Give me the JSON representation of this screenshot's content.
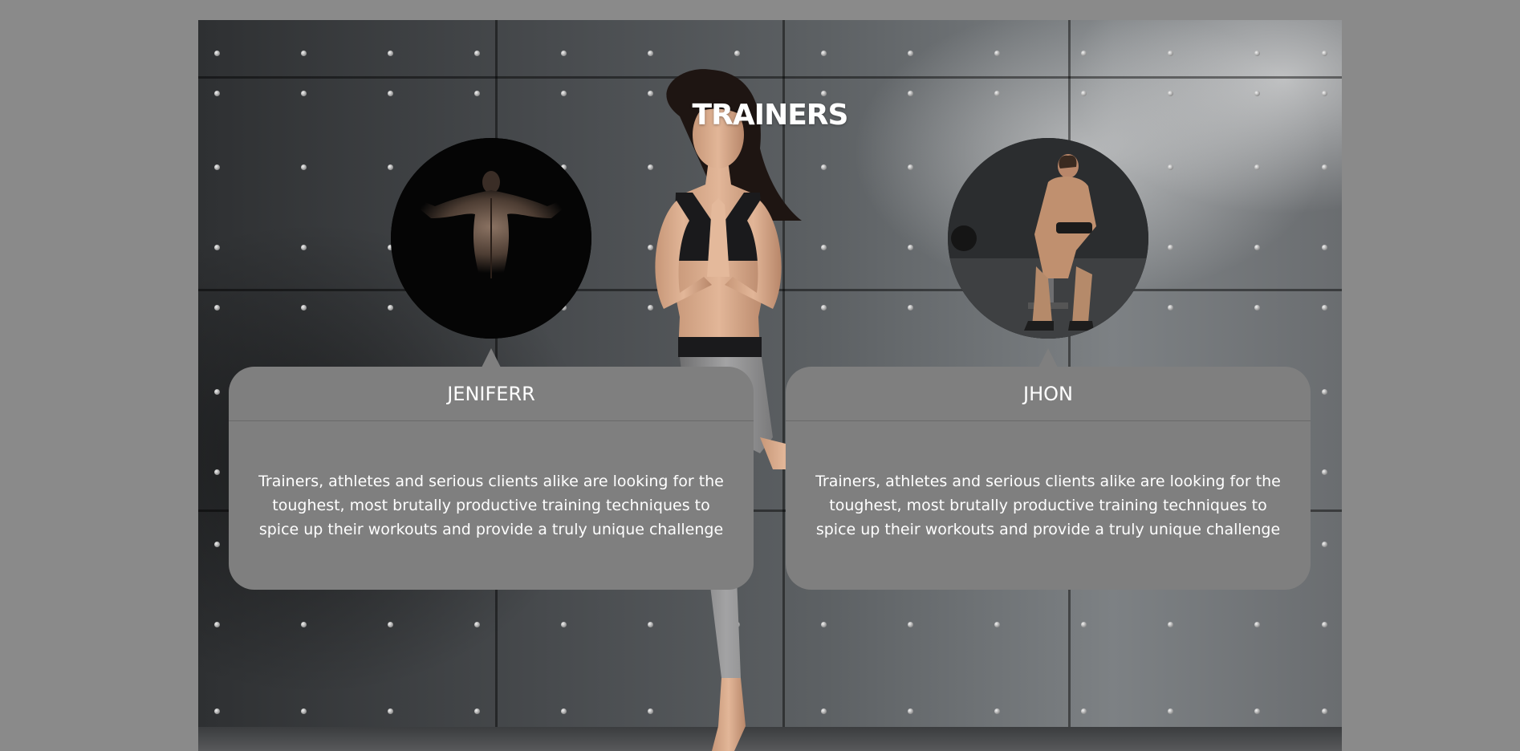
{
  "section": {
    "title": "TRAINERS"
  },
  "trainers": [
    {
      "name": "JENIFERR",
      "bio": "Trainers, athletes and serious clients alike are looking for the toughest, most brutally productive training techniques to spice up their workouts and provide a truly unique challenge"
    },
    {
      "name": "JHON",
      "bio": "Trainers, athletes and serious clients alike are looking for the toughest, most brutally productive training techniques to spice up their workouts and provide a truly unique challenge"
    }
  ]
}
